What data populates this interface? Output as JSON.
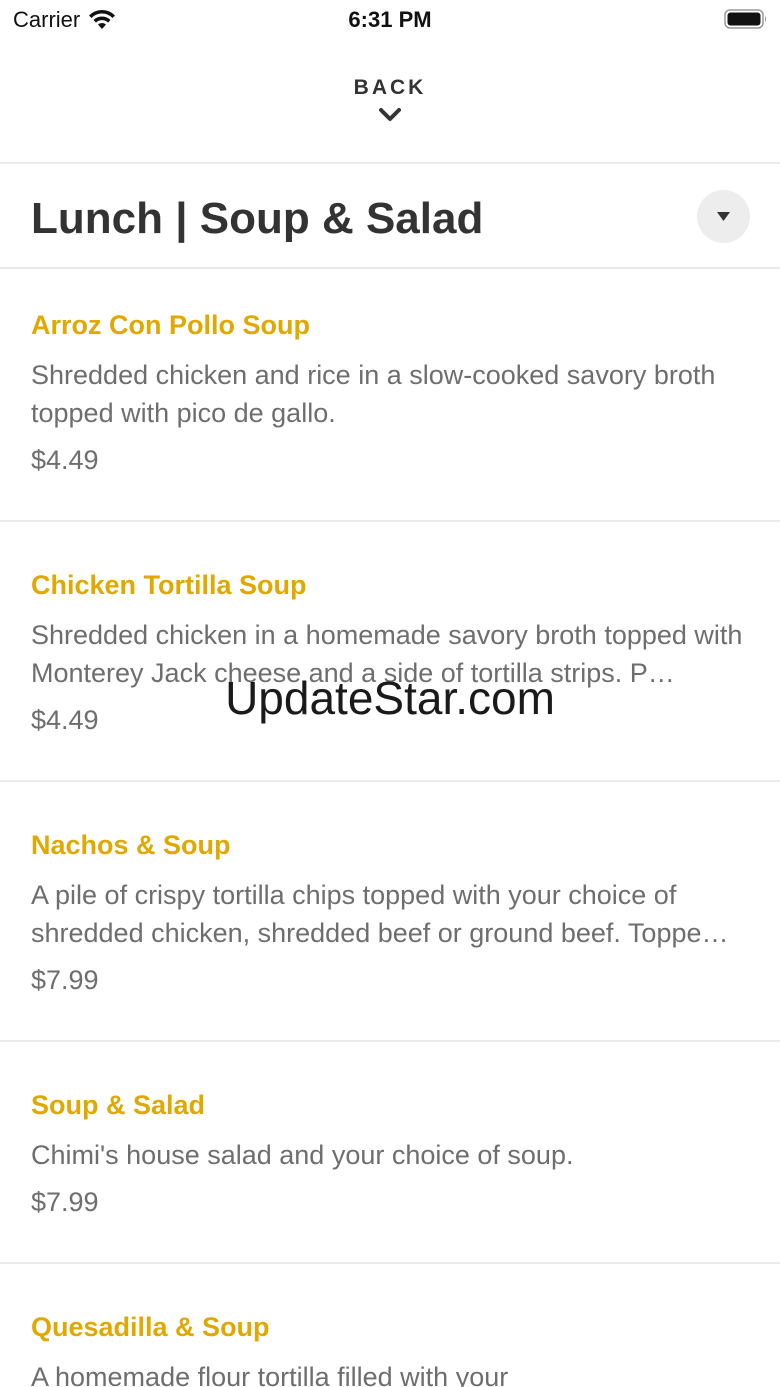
{
  "status_bar": {
    "carrier": "Carrier",
    "time": "6:31 PM"
  },
  "header": {
    "back_label": "BACK"
  },
  "category": {
    "title": "Lunch | Soup & Salad"
  },
  "items": [
    {
      "name": "Arroz Con Pollo Soup",
      "description": "Shredded chicken and rice in a slow-cooked savory broth topped with pico de gallo.",
      "price": "$4.49"
    },
    {
      "name": "Chicken Tortilla Soup",
      "description": "Shredded chicken in a homemade savory broth topped with Monterey Jack cheese and a side of tortilla strips. P…",
      "price": "$4.49"
    },
    {
      "name": "Nachos & Soup",
      "description": "A pile of crispy tortilla chips topped with your choice of shredded chicken, shredded beef or ground beef. Toppe…",
      "price": "$7.99"
    },
    {
      "name": "Soup & Salad",
      "description": "Chimi's house salad and your choice of soup.",
      "price": "$7.99"
    },
    {
      "name": "Quesadilla & Soup",
      "description": "A homemade flour tortilla filled with your",
      "price": ""
    }
  ],
  "watermark": "UpdateStar.com",
  "colors": {
    "item_name": "#e0a800",
    "description": "#6e6e6e",
    "title": "#333333",
    "divider": "#ebebeb",
    "dropdown_bg": "#ededed"
  }
}
